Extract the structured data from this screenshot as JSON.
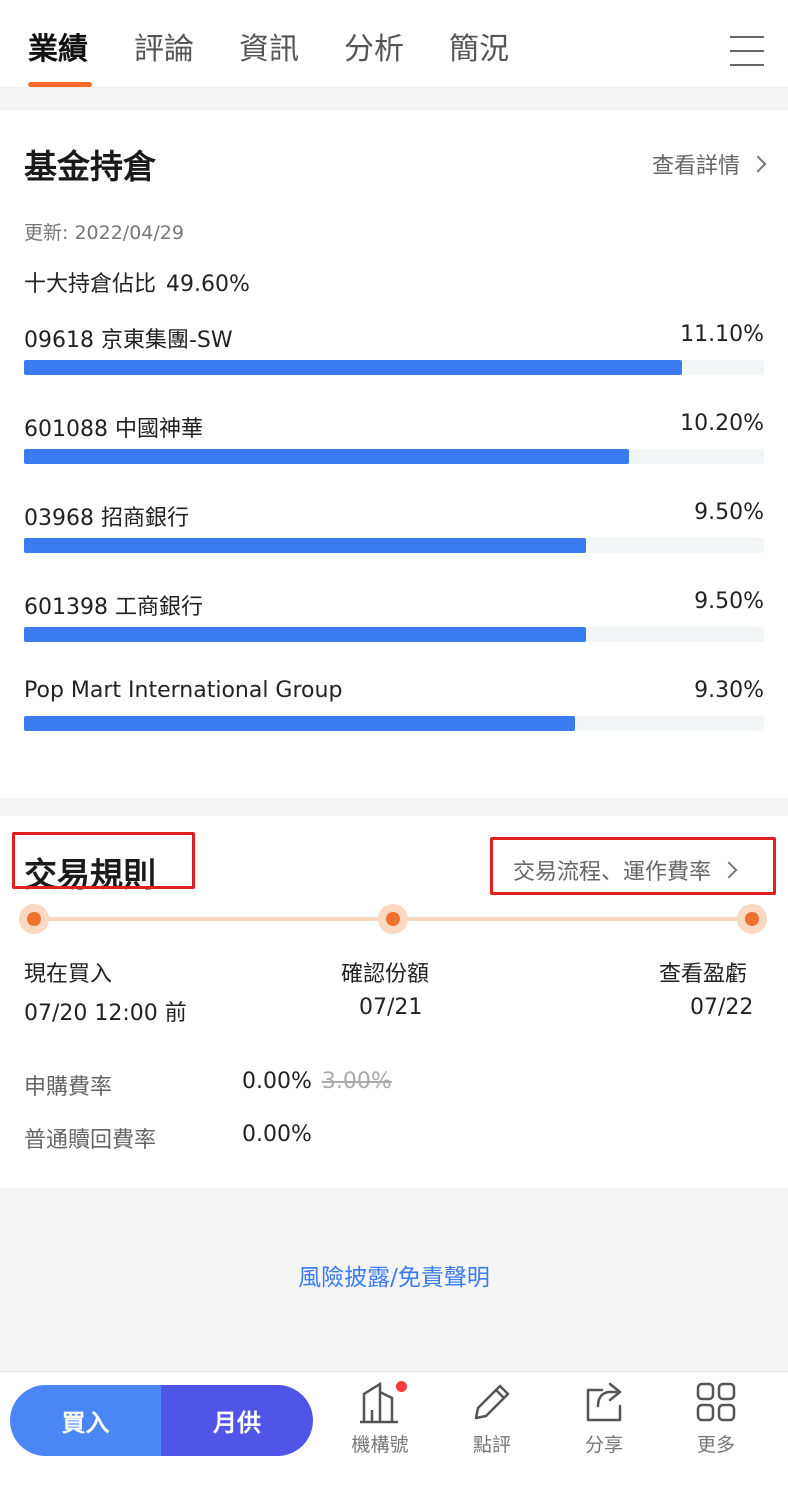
{
  "tabs": [
    {
      "label": "業績"
    },
    {
      "label": "評論"
    },
    {
      "label": "資訊"
    },
    {
      "label": "分析"
    },
    {
      "label": "簡況"
    }
  ],
  "holdings": {
    "title": "基金持倉",
    "detail_link": "查看詳情",
    "update_text": "更新: 2022/04/29",
    "top10_label": "十大持倉佔比",
    "top10_value": "49.60%",
    "items": [
      {
        "name": "09618 京東集團-SW",
        "value": "11.10%",
        "fill": 0.889
      },
      {
        "name": "601088 中國神華",
        "value": "10.20%",
        "fill": 0.817
      },
      {
        "name": "03968 招商銀行",
        "value": "9.50%",
        "fill": 0.76
      },
      {
        "name": "601398 工商銀行",
        "value": "9.50%",
        "fill": 0.76
      },
      {
        "name": "Pop Mart International Group",
        "value": "9.30%",
        "fill": 0.745
      }
    ]
  },
  "rules": {
    "title": "交易規則",
    "process_link": "交易流程、運作費率",
    "steps": [
      {
        "label": "現在買入",
        "date": "07/20 12:00 前"
      },
      {
        "label": "確認份額",
        "date": "07/21"
      },
      {
        "label": "查看盈虧",
        "date": "07/22"
      }
    ],
    "fees": [
      {
        "label": "申購費率",
        "value": "0.00%",
        "old": "3.00%"
      },
      {
        "label": "普通贖回費率",
        "value": "0.00%"
      }
    ]
  },
  "disclaimer": "風險披露/免責聲明",
  "bottom": {
    "buy": "買入",
    "monthly": "月供",
    "nav": [
      {
        "label": "機構號",
        "icon": "building-icon"
      },
      {
        "label": "點評",
        "icon": "pencil-icon"
      },
      {
        "label": "分享",
        "icon": "share-icon"
      },
      {
        "label": "更多",
        "icon": "grid-icon"
      }
    ]
  },
  "colors": {
    "accent": "#ff6a2a",
    "bar": "#3a7cf0",
    "buy": "#4a86f5",
    "monthly": "#4f55e6"
  }
}
